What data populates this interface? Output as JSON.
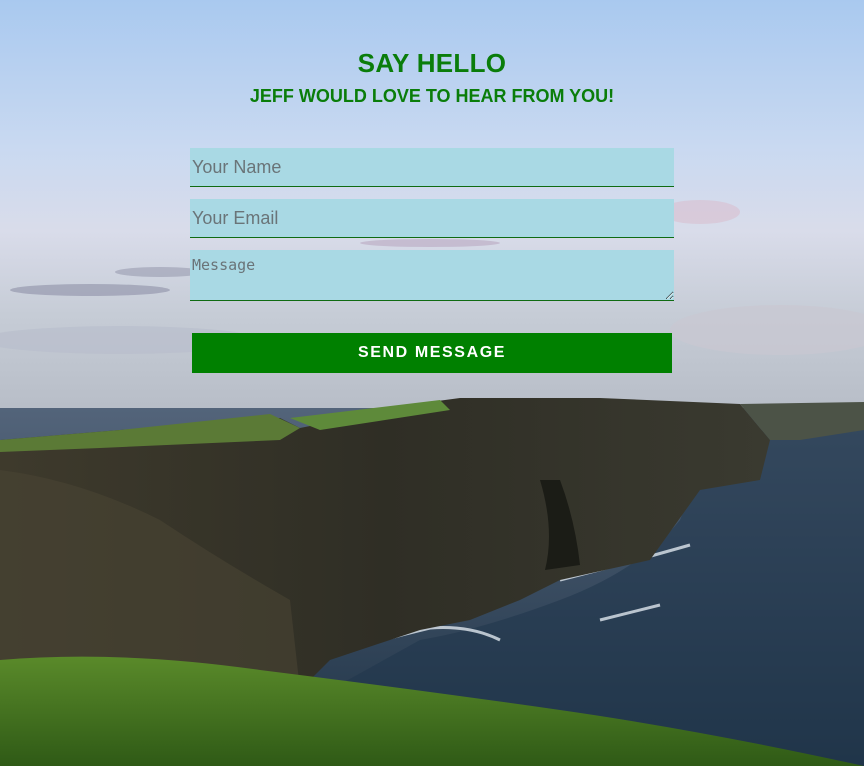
{
  "contact": {
    "title": "SAY HELLO",
    "subtitle": "JEFF WOULD LOVE TO HEAR FROM YOU!",
    "name_placeholder": "Your Name",
    "email_placeholder": "Your Email",
    "message_placeholder": "Message",
    "send_label": "SEND MESSAGE"
  },
  "colors": {
    "accent": "#008000",
    "heading": "#0a7d0a",
    "field_bg": "#a9d9e4"
  }
}
